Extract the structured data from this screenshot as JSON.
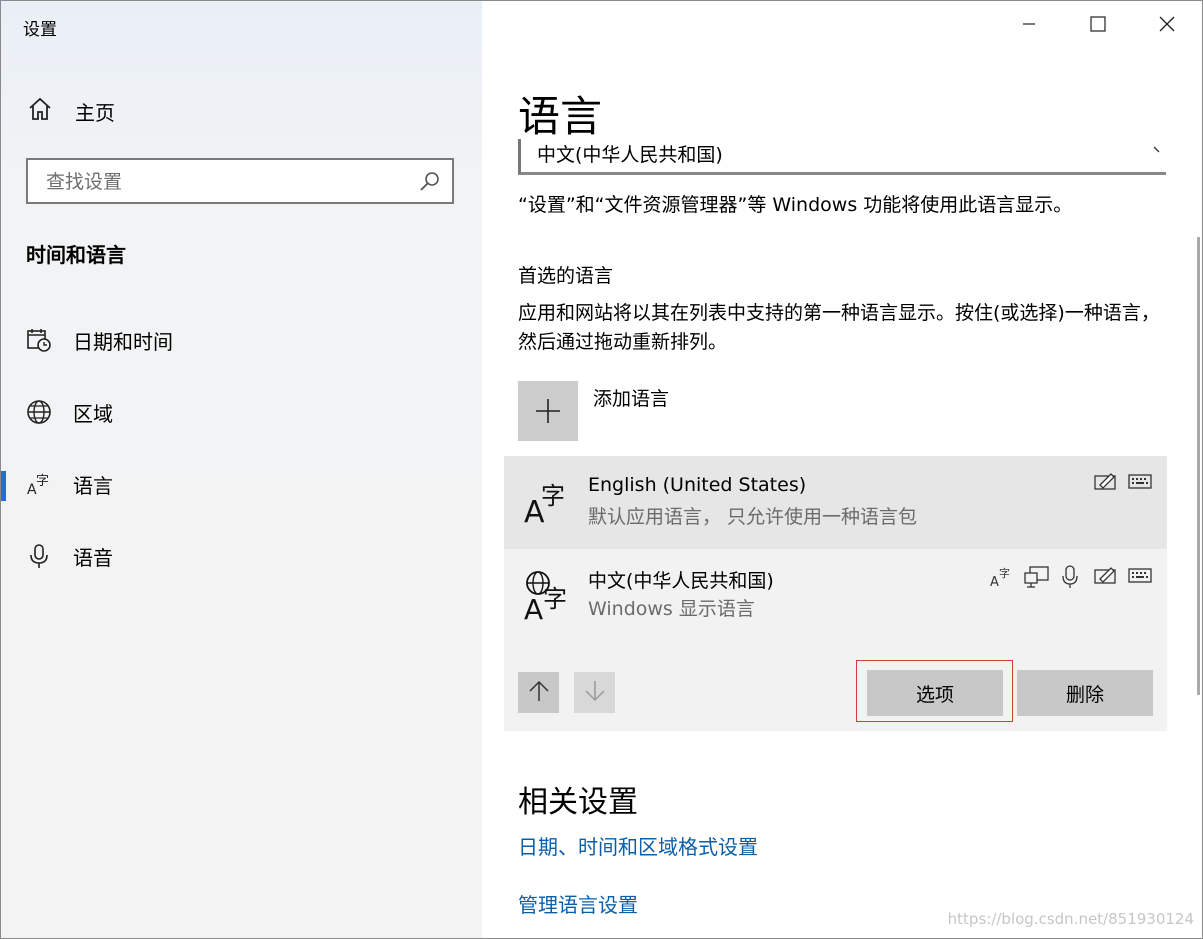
{
  "window": {
    "title": "设置",
    "controls": [
      "minimize-icon",
      "maximize-icon",
      "close-icon"
    ]
  },
  "sidebar": {
    "home_label": "主页",
    "search_placeholder": "查找设置",
    "section_title": "时间和语言",
    "items": [
      {
        "label": "日期和时间",
        "icon": "calendar-clock-icon",
        "active": false
      },
      {
        "label": "区域",
        "icon": "globe-icon",
        "active": false
      },
      {
        "label": "语言",
        "icon": "language-icon",
        "active": true
      },
      {
        "label": "语音",
        "icon": "microphone-icon",
        "active": false
      }
    ]
  },
  "main": {
    "title": "语言",
    "display_language_value": "中文(中华人民共和国)",
    "display_language_desc": "“设置”和“文件资源管理器”等 Windows 功能将使用此语言显示。",
    "preferred_title": "首选的语言",
    "preferred_desc": "应用和网站将以其在列表中支持的第一种语言显示。按住(或选择)一种语言，然后通过拖动重新排列。",
    "add_language_label": "添加语言",
    "languages": [
      {
        "name": "English (United States)",
        "sub": "默认应用语言， 只允许使用一种语言包",
        "features": [
          "handwriting-icon",
          "keyboard-icon"
        ]
      },
      {
        "name": "中文(中华人民共和国)",
        "sub": "Windows 显示语言",
        "features": [
          "language-pack-icon",
          "display-icon",
          "speech-icon",
          "handwriting-icon",
          "keyboard-icon"
        ]
      }
    ],
    "options_label": "选项",
    "remove_label": "删除",
    "related_title": "相关设置",
    "related_links": [
      "日期、时间和区域格式设置",
      "管理语言设置"
    ]
  },
  "watermark": "https://blog.csdn.net/851930124"
}
